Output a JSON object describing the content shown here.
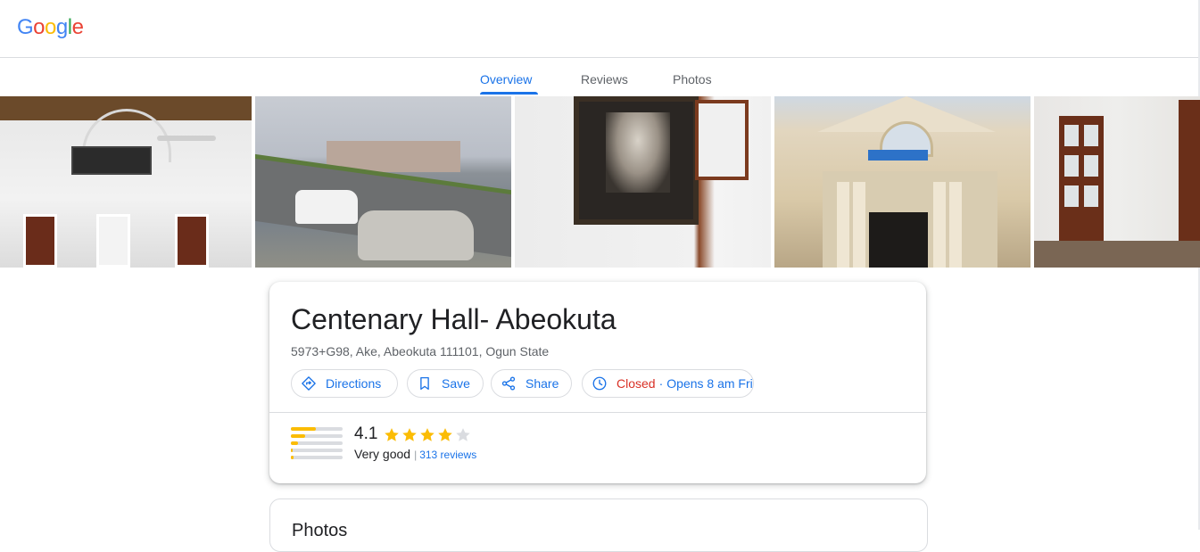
{
  "header": {
    "logo": [
      "G",
      "o",
      "o",
      "g",
      "l",
      "e"
    ]
  },
  "tabs": [
    {
      "label": "Overview",
      "active": true
    },
    {
      "label": "Reviews",
      "active": false
    },
    {
      "label": "Photos",
      "active": false
    }
  ],
  "photos_strip": {
    "count": 5
  },
  "place": {
    "title": "Centenary Hall- Abeokuta",
    "address": "5973+G98, Ake, Abeokuta 111101, Ogun State"
  },
  "actions": {
    "directions": "Directions",
    "save": "Save",
    "share": "Share",
    "hours_status": "Closed",
    "hours_separator": "·",
    "hours_next": "Opens 8 am Fri"
  },
  "rating": {
    "value": "4.1",
    "stars_filled": 4,
    "stars_total": 5,
    "label": "Very good",
    "separator": "|",
    "reviews": "313 reviews",
    "distribution": [
      0.48,
      0.28,
      0.14,
      0.04,
      0.06
    ]
  },
  "sections": {
    "photos_heading": "Photos"
  },
  "colors": {
    "accent": "#1a73e8",
    "closed": "#d93025",
    "star": "#fbbc04",
    "star_empty": "#dadce0"
  },
  "icons": {
    "directions": "directions-icon",
    "save": "bookmark-icon",
    "share": "share-icon",
    "hours": "clock-icon"
  }
}
